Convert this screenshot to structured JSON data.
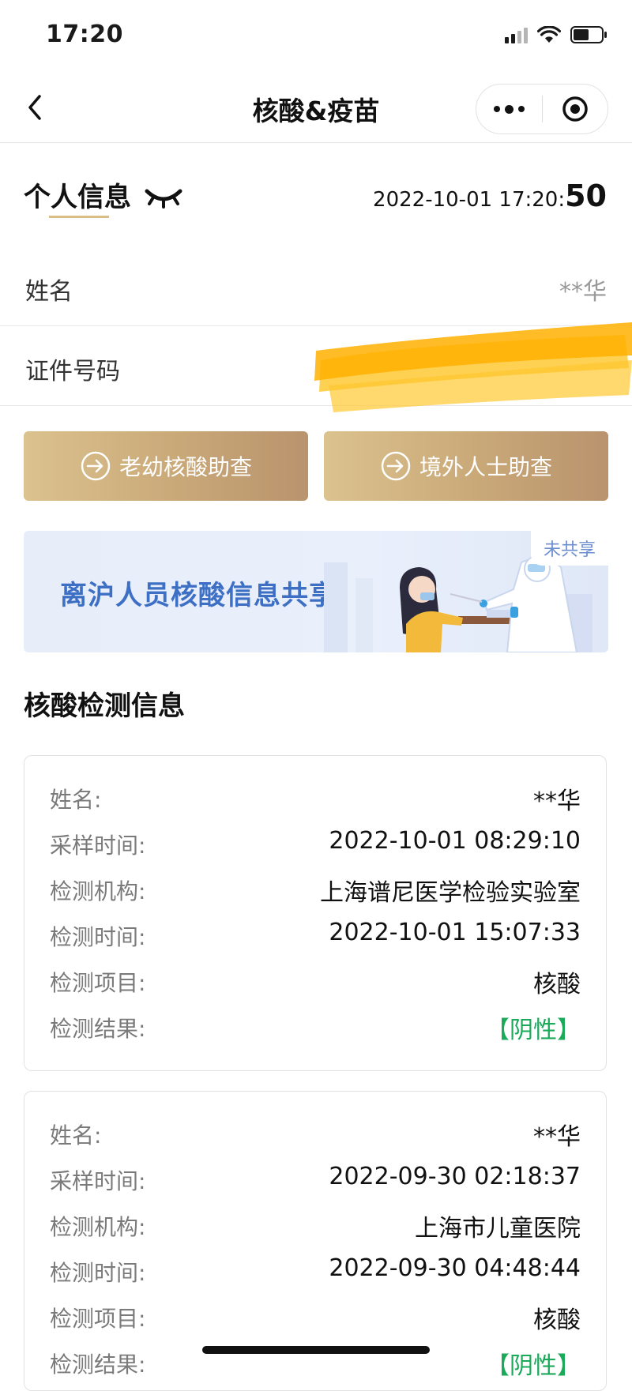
{
  "status_bar": {
    "time": "17:20"
  },
  "nav": {
    "title": "核酸&疫苗"
  },
  "personal": {
    "title": "个人信息",
    "timestamp_main": "2022-10-01 17:20:",
    "timestamp_seconds": "50",
    "name_label": "姓名",
    "name_value": "**华",
    "id_label": "证件号码"
  },
  "buttons": {
    "elderly_check": "老幼核酸助查",
    "overseas_check": "境外人士助查"
  },
  "banner": {
    "title": "离沪人员核酸信息共享",
    "badge": "未共享"
  },
  "nat": {
    "title": "核酸检测信息",
    "labels": {
      "name": "姓名:",
      "sample_time": "采样时间:",
      "institution": "检测机构:",
      "test_time": "检测时间:",
      "item": "检测项目:",
      "result": "检测结果:"
    },
    "records": [
      {
        "name": "**华",
        "sample_time": "2022-10-01 08:29:10",
        "institution": "上海谱尼医学检验实验室",
        "test_time": "2022-10-01 15:07:33",
        "item": "核酸",
        "result": "【阴性】"
      },
      {
        "name": "**华",
        "sample_time": "2022-09-30 02:18:37",
        "institution": "上海市儿童医院",
        "test_time": "2022-09-30 04:48:44",
        "item": "核酸",
        "result": "【阴性】"
      }
    ]
  },
  "colors": {
    "gold_start": "#dbc28e",
    "gold_end": "#b9936d",
    "banner_text": "#3d6fc4",
    "negative_result": "#1aaa5a",
    "redaction": "#ffb000"
  }
}
